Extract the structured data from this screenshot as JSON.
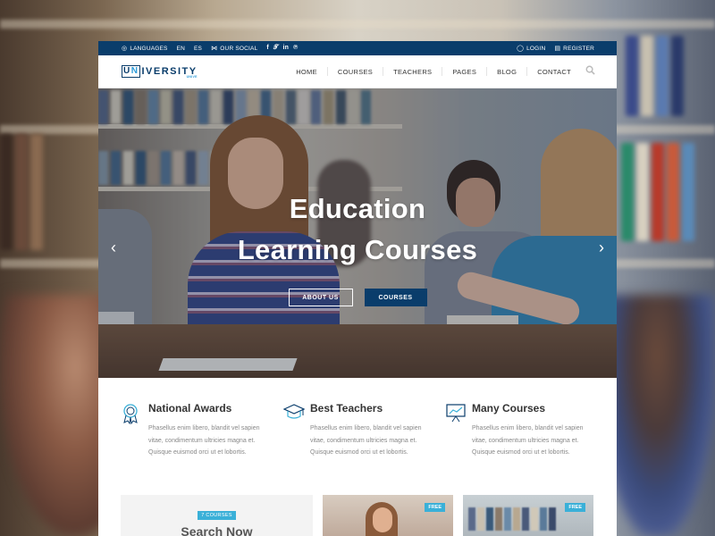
{
  "topbar": {
    "languages_label": "LANGUAGES",
    "lang_en": "EN",
    "lang_es": "ES",
    "social_label": "OUR SOCIAL",
    "social_icons": [
      "facebook-icon",
      "twitter-icon",
      "linkedin-icon",
      "pinterest-icon"
    ],
    "login_label": "LOGIN",
    "register_label": "REGISTER"
  },
  "logo": {
    "letter_u": "U",
    "letter_n": "N",
    "rest": "IVERSITY",
    "tagline": "UNIVE"
  },
  "nav": {
    "items": [
      "HOME",
      "COURSES",
      "TEACHERS",
      "PAGES",
      "BLOG",
      "CONTACT"
    ]
  },
  "hero": {
    "title_line1": "Education",
    "title_line2": "Learning Courses",
    "btn_about": "ABOUT US",
    "btn_courses": "COURSES",
    "prev_arrow": "‹",
    "next_arrow": "›"
  },
  "features": [
    {
      "title": "National Awards",
      "icon": "award-icon",
      "text": "Phasellus enim libero, blandit vel sapien vitae, condimentum ultricies magna et. Quisque euismod orci ut et lobortis."
    },
    {
      "title": "Best Teachers",
      "icon": "graduation-cap-icon",
      "text": "Phasellus enim libero, blandit vel sapien vitae, condimentum ultricies magna et. Quisque euismod orci ut et lobortis."
    },
    {
      "title": "Many Courses",
      "icon": "presentation-board-icon",
      "text": "Phasellus enim libero, blandit vel sapien vitae, condimentum ultricies magna et. Quisque euismod orci ut et lobortis."
    }
  ],
  "cards": {
    "search_badge": "7 COURSES",
    "search_title": "Search Now",
    "free_label": "FREE"
  },
  "colors": {
    "primary": "#0a3d6b",
    "accent": "#3ab0d8",
    "text": "#333333",
    "muted": "#888888"
  }
}
